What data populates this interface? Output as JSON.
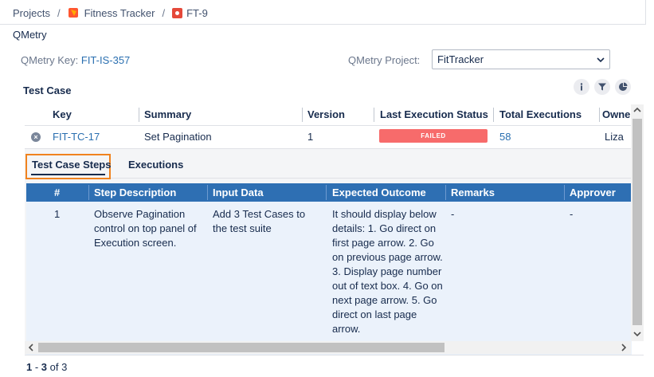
{
  "breadcrumb": {
    "root": "Projects",
    "project": "Fitness Tracker",
    "issue": "FT-9"
  },
  "panel": {
    "title": "QMetry"
  },
  "qmetry_key": {
    "label": "QMetry Key:",
    "value": "FIT-IS-357"
  },
  "qmetry_project": {
    "label": "QMetry Project:",
    "selected": "FitTracker"
  },
  "section": {
    "title": "Test Case",
    "icons": [
      "info-icon",
      "filter-icon",
      "pie-chart-icon"
    ]
  },
  "grid": {
    "columns": [
      "Key",
      "Summary",
      "Version",
      "Last Execution Status",
      "Total Executions",
      "Owne"
    ],
    "row": {
      "key": "FIT-TC-17",
      "summary": "Set Pagination",
      "version": "1",
      "status": "FAILED",
      "total_executions": "58",
      "owner": "Liza"
    }
  },
  "detail": {
    "tabs": [
      "Test Case Steps",
      "Executions"
    ],
    "active_tab": "Test Case Steps",
    "columns": [
      "#",
      "Step Description",
      "Input Data",
      "Expected Outcome",
      "Remarks",
      "Approver"
    ],
    "step": {
      "num": "1",
      "description": "Observe Pagination control on top panel of Execution screen.",
      "input": "Add 3 Test Cases to the test suite",
      "expected": "It should display below details: 1. Go direct on first page arrow. 2. Go on previous page arrow. 3. Display page number out of text box. 4. Go on next page arrow. 5. Go direct on last page arrow.",
      "remarks": "-",
      "approver": "-"
    }
  },
  "pager": {
    "from": "1",
    "to": "3",
    "of_label": "of",
    "total": "3"
  },
  "colors": {
    "accent": "#2e6fb3",
    "failed": "#f76b6b",
    "focus": "#f0821e",
    "link": "#2a6fb0"
  }
}
